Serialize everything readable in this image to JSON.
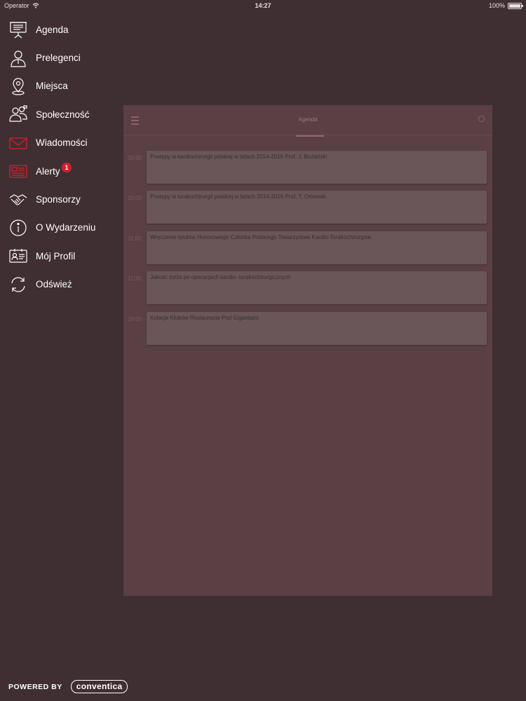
{
  "status_bar": {
    "carrier": "Operator",
    "time": "14:27",
    "battery": "100%"
  },
  "menu": {
    "items": [
      {
        "label": "Agenda",
        "icon": "presentation-board-icon"
      },
      {
        "label": "Prelegenci",
        "icon": "speaker-person-icon"
      },
      {
        "label": "Miejsca",
        "icon": "location-pin-icon"
      },
      {
        "label": "Społeczność",
        "icon": "community-people-icon"
      },
      {
        "label": "Wiadomości",
        "icon": "envelope-icon"
      },
      {
        "label": "Alerty",
        "icon": "alert-document-icon",
        "badge": "1"
      },
      {
        "label": "Sponsorzy",
        "icon": "handshake-icon"
      },
      {
        "label": "O Wydarzeniu",
        "icon": "info-icon"
      },
      {
        "label": "Mój Profil",
        "icon": "profile-card-icon"
      },
      {
        "label": "Odśwież",
        "icon": "refresh-icon"
      }
    ]
  },
  "panel": {
    "title": "Agenda",
    "rows": [
      {
        "time": "09:00",
        "title": "Postępy w kardiochirurgii polskiej w latach 2014-2016  Prof. J. Bożański"
      },
      {
        "time": "10:00",
        "title": "Postępy w torakochirurgii polskiej w latach 2014-2016  Prof. T. Orłowski"
      },
      {
        "time": "11:00",
        "title": "Wręczenie tytułów Honorowego Członka Polskiego Towarzystwa Kardio-Torakochirurgów."
      },
      {
        "time": "11:30",
        "title": "Jakość życia po operacjach kardio- torakochirurgicznych"
      },
      {
        "time": "19:00",
        "title": "Kolacja Klubów Restauracja Pod Gigantami"
      }
    ]
  },
  "footer": {
    "powered_by": "POWERED BY",
    "brand": "conventica"
  },
  "colors": {
    "background": "#3f2f33",
    "accent": "#d3202a",
    "panel": "#5a3f44"
  }
}
